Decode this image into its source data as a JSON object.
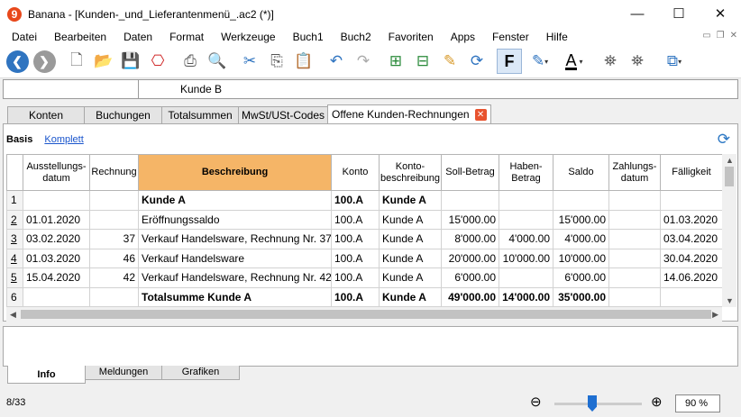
{
  "window": {
    "title": "Banana - [Kunden-_und_Lieferantenmenü_.ac2 (*)]",
    "logo": "9",
    "minimize": "—",
    "maximize": "☐",
    "close": "✕"
  },
  "menu": [
    "Datei",
    "Bearbeiten",
    "Daten",
    "Format",
    "Werkzeuge",
    "Buch1",
    "Buch2",
    "Favoriten",
    "Apps",
    "Fenster",
    "Hilfe"
  ],
  "toolbar": {
    "icons": [
      "back-icon",
      "forward-icon",
      "new-file-icon",
      "open-file-icon",
      "save-icon",
      "pdf-icon",
      "print-icon",
      "print-preview-icon",
      "cut-icon",
      "copy-icon",
      "paste-icon",
      "undo-icon",
      "redo-icon",
      "add-row-icon",
      "insert-row-icon",
      "edit-icon",
      "refresh-icon",
      "bold-icon",
      "highlight-icon",
      "text-color-icon",
      "find-icon",
      "find-next-icon",
      "window-icon"
    ],
    "bold_label": "F",
    "text_color_label": "A"
  },
  "cell": {
    "address": "",
    "value": "Kunde B"
  },
  "tabs": [
    "Konten",
    "Buchungen",
    "Totalsummen",
    "MwSt/USt-Codes",
    "Offene Kunden-Rechnungen"
  ],
  "views": {
    "basis": "Basis",
    "komplett": "Komplett"
  },
  "table": {
    "columns": [
      "",
      "Ausstellungs-datum",
      "Rechnung",
      "Beschreibung",
      "Konto",
      "Konto-beschreibung",
      "Soll-Betrag",
      "Haben-Betrag",
      "Saldo",
      "Zahlungs-datum",
      "Fälligkeit"
    ],
    "rows": [
      {
        "n": "1",
        "link": false,
        "bold": true,
        "cells": [
          "",
          "",
          "Kunde A",
          "100.A",
          "Kunde A",
          "",
          "",
          "",
          "",
          ""
        ]
      },
      {
        "n": "2",
        "link": true,
        "bold": false,
        "cells": [
          "01.01.2020",
          "",
          "Eröffnungssaldo",
          "100.A",
          "Kunde A",
          "15'000.00",
          "",
          "15'000.00",
          "",
          "01.03.2020"
        ]
      },
      {
        "n": "3",
        "link": true,
        "bold": false,
        "cells": [
          "03.02.2020",
          "37",
          "Verkauf Handelsware, Rechnung Nr. 37",
          "100.A",
          "Kunde A",
          "8'000.00",
          "4'000.00",
          "4'000.00",
          "",
          "03.04.2020"
        ]
      },
      {
        "n": "4",
        "link": true,
        "bold": false,
        "cells": [
          "01.03.2020",
          "46",
          "Verkauf Handelsware",
          "100.A",
          "Kunde A",
          "20'000.00",
          "10'000.00",
          "10'000.00",
          "",
          "30.04.2020"
        ]
      },
      {
        "n": "5",
        "link": true,
        "bold": false,
        "cells": [
          "15.04.2020",
          "42",
          "Verkauf Handelsware, Rechnung Nr. 42",
          "100.A",
          "Kunde A",
          "6'000.00",
          "",
          "6'000.00",
          "",
          "14.06.2020"
        ]
      },
      {
        "n": "6",
        "link": false,
        "bold": true,
        "cells": [
          "",
          "",
          "Totalsumme Kunde A",
          "100.A",
          "Kunde A",
          "49'000.00",
          "14'000.00",
          "35'000.00",
          "",
          ""
        ]
      }
    ]
  },
  "bottom_tabs": [
    "Info",
    "Meldungen",
    "Grafiken"
  ],
  "status": {
    "count": "8/33",
    "zoom": "90 %",
    "zoom_level_percent": 90
  }
}
